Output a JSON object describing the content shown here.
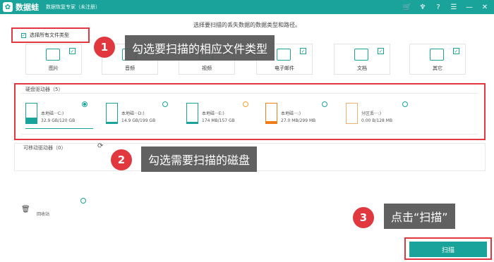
{
  "titlebar": {
    "logo_glyph": "✿",
    "app_name": "数据蛙",
    "app_subtitle": "数据恢复专家（未注册）",
    "icons": [
      "cart-icon",
      "pin-icon",
      "help-icon",
      "chat-icon",
      "minimize-icon",
      "close-icon"
    ]
  },
  "hint": "选择要扫描的丢失数据的数据类型和路径。",
  "select_all": {
    "label": "选择所有文件类型",
    "checked": true
  },
  "file_types": [
    {
      "label": "图片",
      "checked": true
    },
    {
      "label": "音频",
      "checked": true
    },
    {
      "label": "视频",
      "checked": true
    },
    {
      "label": "电子邮件",
      "checked": true
    },
    {
      "label": "文档",
      "checked": true
    },
    {
      "label": "其它",
      "checked": true
    }
  ],
  "hard_drives": {
    "title": "硬盘驱动器（5）",
    "disks": [
      {
        "name": "本地磁···C:)",
        "size": "32.9 GB/120 GB",
        "fill": 0.27,
        "color": "#1aa39a",
        "selected": true
      },
      {
        "name": "本地磁···D:)",
        "size": "14.9 GB/199 GB",
        "fill": 0.07,
        "color": "#1aa39a",
        "selected": false
      },
      {
        "name": "本地磁···E:)",
        "size": "174 MB/157 GB",
        "fill": 0.01,
        "color": "#1aa39a",
        "selected": false
      },
      {
        "name": "本地磁···:)",
        "size": "27.0 MB/299 MB",
        "fill": 0.09,
        "color": "#f07c1a",
        "selected": false
      },
      {
        "name": "分区丢···:)",
        "size": "0.00  B/128 MB",
        "fill": 0.0,
        "color": "#f07c1a",
        "selected": false
      }
    ]
  },
  "removable": {
    "title": "可移动驱动器（0）"
  },
  "recycle": {
    "label": "回收站"
  },
  "scan_button": "扫描",
  "callouts": [
    {
      "num": "1",
      "text": "勾选要扫描的相应文件类型"
    },
    {
      "num": "2",
      "text": "勾选需要扫描的磁盘"
    },
    {
      "num": "3",
      "text": "点击“扫描”"
    }
  ]
}
